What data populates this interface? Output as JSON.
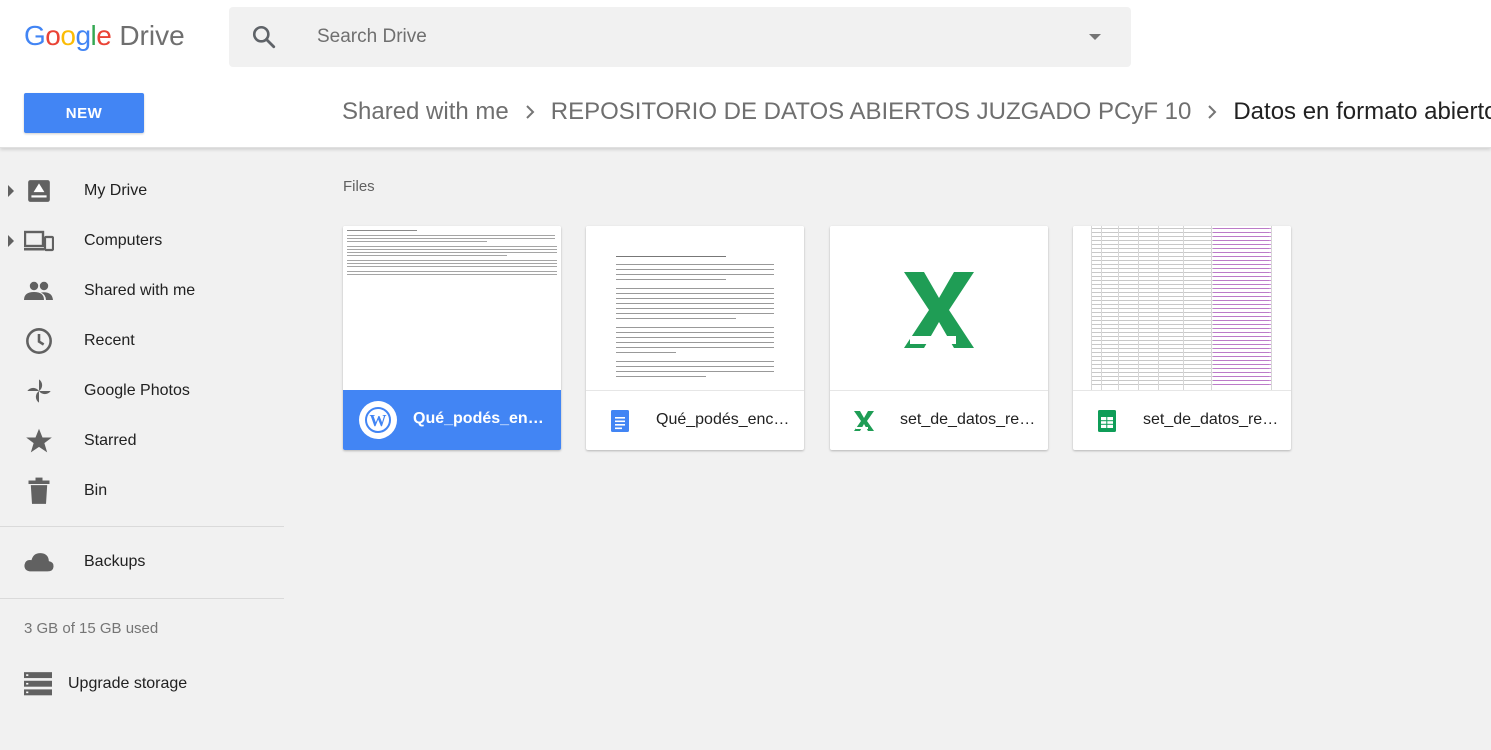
{
  "app": {
    "logo_google": "Google",
    "logo_drive": "Drive"
  },
  "search": {
    "placeholder": "Search Drive"
  },
  "new_button": {
    "label": "NEW"
  },
  "breadcrumb": [
    {
      "label": "Shared with me"
    },
    {
      "label": "REPOSITORIO DE DATOS ABIERTOS JUZGADO PCyF 10"
    },
    {
      "label": "Datos en formato abierto"
    }
  ],
  "sidebar": {
    "items": [
      {
        "label": "My Drive",
        "icon": "my-drive-icon"
      },
      {
        "label": "Computers",
        "icon": "computers-icon"
      },
      {
        "label": "Shared with me",
        "icon": "shared-people-icon"
      },
      {
        "label": "Recent",
        "icon": "clock-icon"
      },
      {
        "label": "Google Photos",
        "icon": "photos-pinwheel-icon"
      },
      {
        "label": "Starred",
        "icon": "star-icon"
      },
      {
        "label": "Bin",
        "icon": "trash-icon"
      },
      {
        "label": "Backups",
        "icon": "cloud-icon"
      }
    ],
    "storage": "3 GB of 15 GB used",
    "upgrade": "Upgrade storage"
  },
  "main": {
    "section_label": "Files",
    "files": [
      {
        "name": "Qué_podés_enc…",
        "type": "word",
        "selected": true
      },
      {
        "name": "Qué_podés_enc…",
        "type": "google-doc"
      },
      {
        "name": "set_de_datos_re…",
        "type": "excel"
      },
      {
        "name": "set_de_datos_re…",
        "type": "google-sheet"
      }
    ]
  },
  "colors": {
    "accent": "#4285f4",
    "excel_green": "#1f9d55",
    "sheets_green": "#0f9d58",
    "docs_blue": "#4285f4"
  }
}
